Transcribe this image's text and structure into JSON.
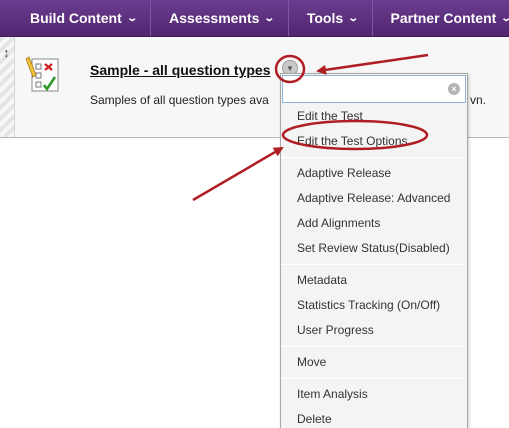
{
  "toolbar": {
    "items": [
      {
        "label": "Build Content",
        "icon": "chevron-down-icon"
      },
      {
        "label": "Assessments",
        "icon": "chevron-down-icon"
      },
      {
        "label": "Tools",
        "icon": "chevron-down-icon"
      },
      {
        "label": "Partner Content",
        "icon": "chevron-down-icon"
      }
    ],
    "color": "#5a2d7f"
  },
  "content_item": {
    "icon": "test-icon",
    "title": "Sample - all question types",
    "description": "Samples of all question types ava",
    "description_tail": "vn."
  },
  "menu": {
    "search_placeholder": "",
    "groups": [
      [
        "Edit the Test",
        "Edit the Test Options"
      ],
      [
        "Adaptive Release",
        "Adaptive Release: Advanced",
        "Add Alignments",
        "Set Review Status(Disabled)"
      ],
      [
        "Metadata",
        "Statistics Tracking (On/Off)",
        "User Progress"
      ],
      [
        "Move"
      ],
      [
        "Item Analysis",
        "Delete"
      ]
    ]
  },
  "annotation_color": "#b01e23"
}
